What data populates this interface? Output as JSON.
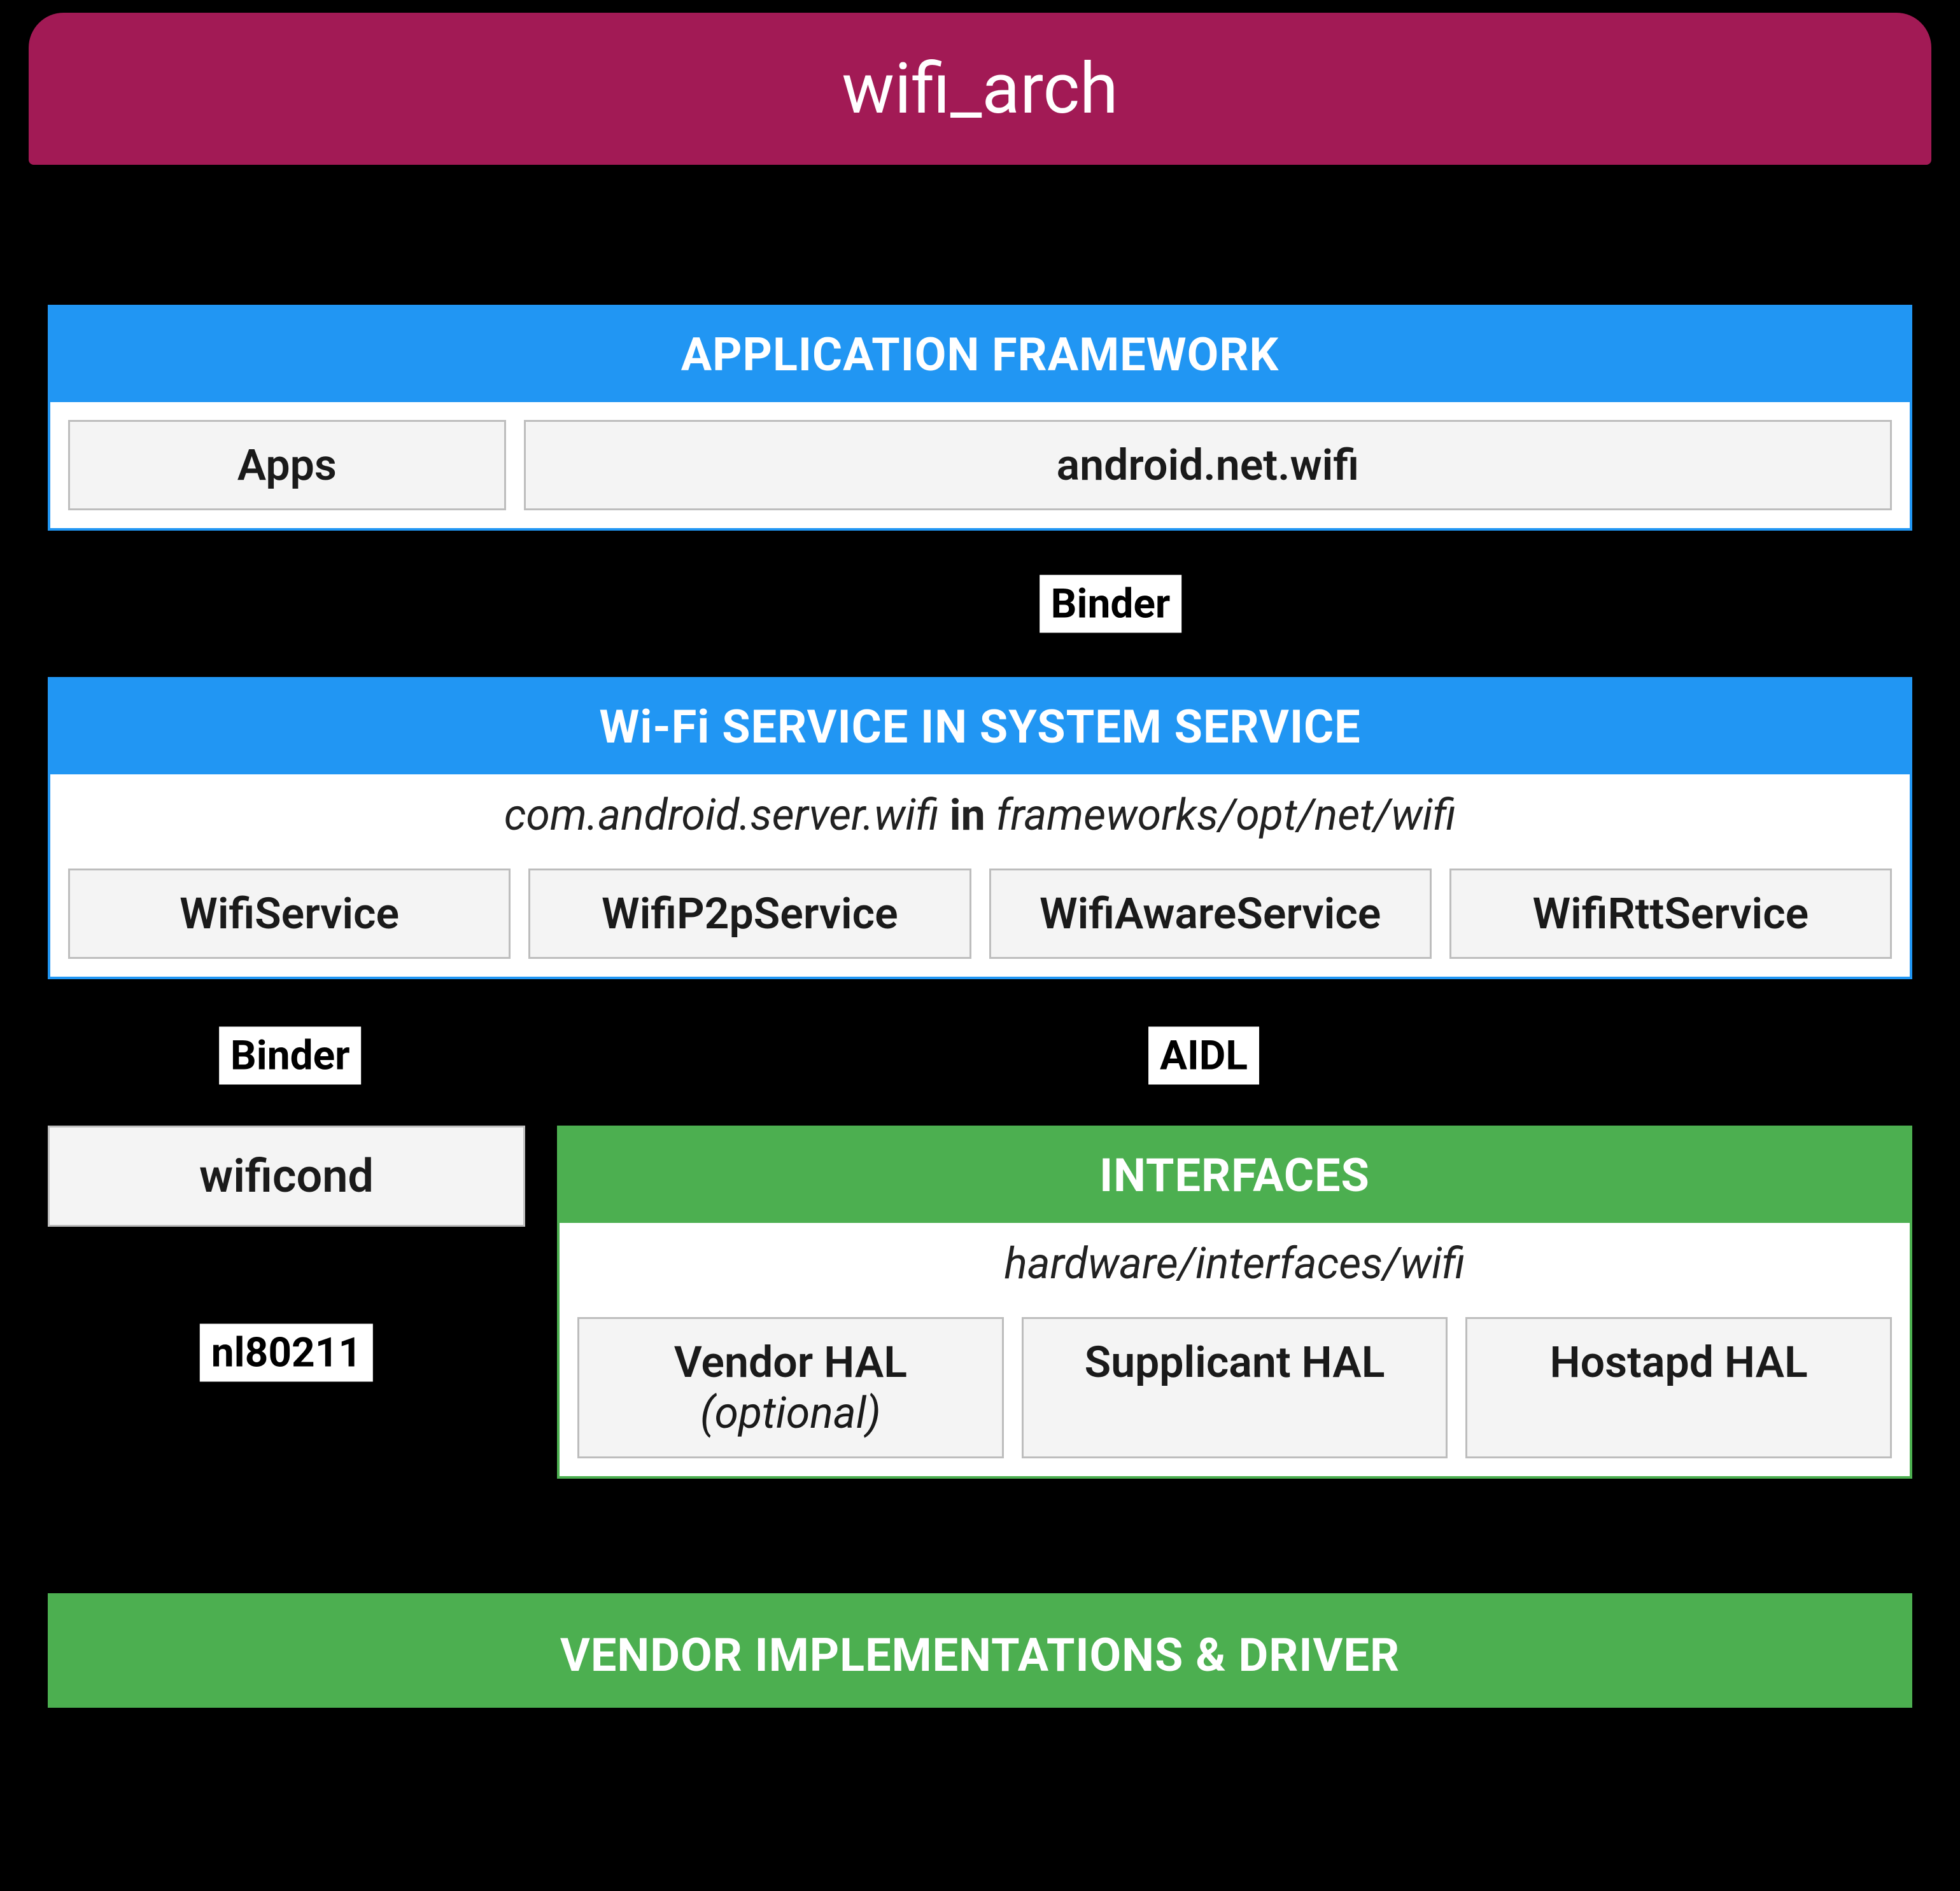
{
  "title": "wifi_arch",
  "app_framework": {
    "header": "APPLICATION FRAMEWORK",
    "apps": "Apps",
    "netwifi": "android.net.wifi"
  },
  "conn1": {
    "binder": "Binder"
  },
  "wifi_service": {
    "header": "Wi-Fi SERVICE IN SYSTEM SERVICE",
    "subtitle_left": "com.android.server.wifi",
    "subtitle_mid": "in",
    "subtitle_right": "frameworks/opt/net/wifi",
    "s1": "WifiService",
    "s2": "WifiP2pService",
    "s3": "WifiAwareService",
    "s4": "WifiRttService"
  },
  "conn2": {
    "binder": "Binder",
    "aidl": "AIDL"
  },
  "wificond": "wificond",
  "nl80211": "nl80211",
  "interfaces": {
    "header": "INTERFACES",
    "subtitle": "hardware/interfaces/wifi",
    "h1a": "Vendor HAL ",
    "h1b": "(optional)",
    "h2": "Supplicant HAL",
    "h3": "Hostapd HAL"
  },
  "vendor": "VENDOR IMPLEMENTATIONS & DRIVER"
}
